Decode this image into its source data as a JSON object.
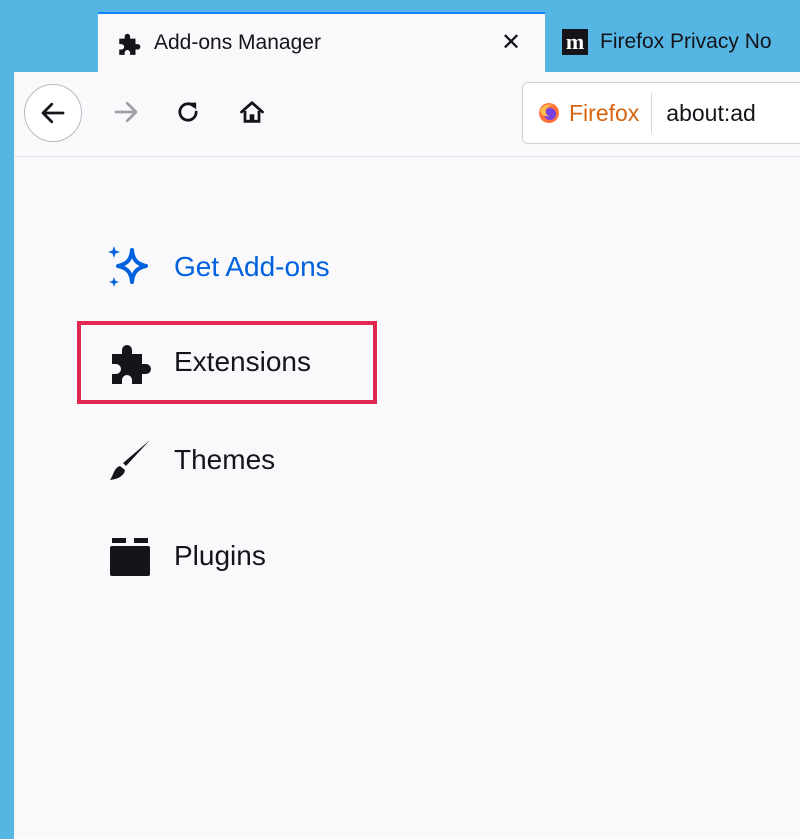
{
  "browser": {
    "tabs": [
      {
        "title": "Add-ons Manager",
        "icon": "puzzle-piece-icon",
        "active": true,
        "close_glyph": "✕"
      },
      {
        "title": "Firefox Privacy No",
        "icon": "m-logo-icon",
        "active": false
      }
    ],
    "toolbar": {
      "back_glyph": "←",
      "forward_glyph": "→",
      "reload_glyph": "↻",
      "home_glyph": "⌂"
    },
    "urlbar": {
      "identity_label": "Firefox",
      "url": "about:ad"
    },
    "accent_color": "#55b6e4"
  },
  "addons": {
    "categories": [
      {
        "label": "Get Add-ons",
        "icon": "sparkle-icon",
        "color": "#0061e0"
      },
      {
        "label": "Extensions",
        "icon": "puzzle-piece-icon",
        "highlighted": true,
        "highlight_color": "#e22850"
      },
      {
        "label": "Themes",
        "icon": "paintbrush-icon"
      },
      {
        "label": "Plugins",
        "icon": "plugin-block-icon"
      }
    ]
  }
}
